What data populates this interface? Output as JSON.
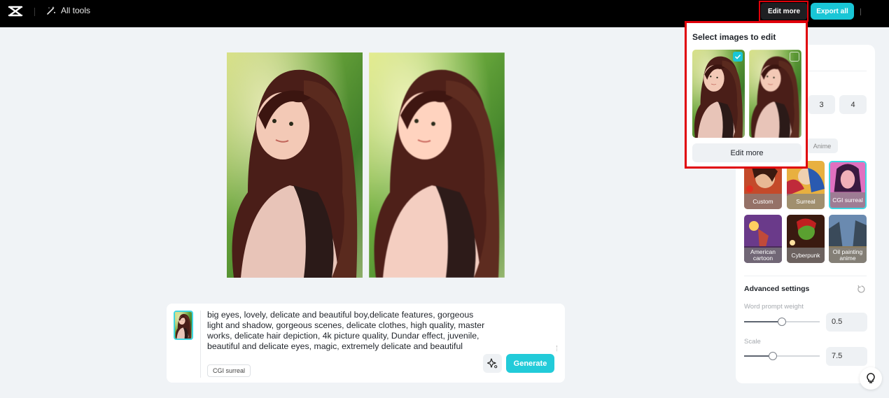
{
  "topbar": {
    "logo": "capcut-logo-icon",
    "all_tools_label": "All tools",
    "edit_more_label": "Edit more",
    "export_all_label": "Export all"
  },
  "generated_images": [
    {
      "alt": "Generated portrait 1"
    },
    {
      "alt": "Generated portrait 2"
    }
  ],
  "prompt": {
    "text": "big eyes, lovely, delicate and beautiful boy,delicate features, gorgeous light and shadow, gorgeous scenes, delicate clothes, high quality, master works, delicate hair depiction, 4k picture quality, Dundar effect, juvenile, beautiful and delicate eyes, magic, extremely delicate and beautiful",
    "style_tag": "CGI surreal",
    "generate_label": "Generate"
  },
  "popup": {
    "title": "Select images to edit",
    "images": [
      {
        "selected": true
      },
      {
        "selected": false
      }
    ],
    "button_label": "Edit more"
  },
  "panel": {
    "counts": [
      "3",
      "4"
    ],
    "visible_tab": "Anime",
    "styles": [
      {
        "label": "Custom",
        "selected": false
      },
      {
        "label": "Surreal",
        "selected": false
      },
      {
        "label": "CGI surreal",
        "selected": true
      },
      {
        "label": "American cartoon",
        "selected": false
      },
      {
        "label": "Cyberpunk",
        "selected": false
      },
      {
        "label": "Oil painting anime",
        "selected": false
      }
    ],
    "advanced_title": "Advanced settings",
    "word_prompt_weight": {
      "label": "Word prompt weight",
      "value": "0.5",
      "fraction": 0.5
    },
    "scale": {
      "label": "Scale",
      "value": "7.5",
      "fraction": 0.38
    }
  },
  "colors": {
    "accent": "#19c6d6",
    "highlight": "#e0000a"
  }
}
